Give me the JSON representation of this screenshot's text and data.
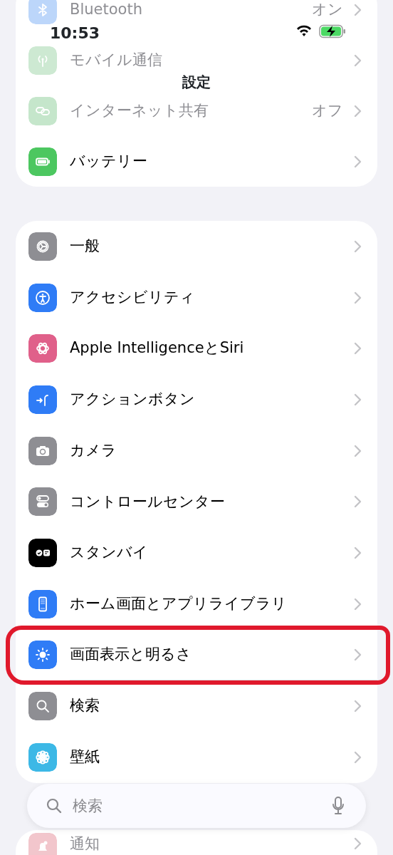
{
  "status_bar": {
    "time": "10:53"
  },
  "title": "設定",
  "groups": [
    {
      "items": [
        {
          "label": "Bluetooth",
          "value": "オン",
          "color": "#bcd6fa",
          "faded": true,
          "highlighted": false
        },
        {
          "label": "モバイル通信",
          "color": "#cde9d2",
          "faded": true,
          "highlighted": false
        },
        {
          "label": "インターネット共有",
          "value": "オフ",
          "color": "#c5e6cb",
          "faded": true,
          "highlighted": false
        },
        {
          "label": "バッテリー",
          "color": "#4cc760",
          "faded": false,
          "highlighted": false
        }
      ]
    },
    {
      "items": [
        {
          "label": "一般",
          "color": "#8e8e93",
          "faded": false,
          "highlighted": false
        },
        {
          "label": "アクセシビリティ",
          "color": "#2f7cf6",
          "faded": false,
          "highlighted": false
        },
        {
          "label": "Apple IntelligenceとSiri",
          "color": "#e0608a",
          "faded": false,
          "highlighted": false
        },
        {
          "label": "アクションボタン",
          "color": "#2f7cf6",
          "faded": false,
          "highlighted": false
        },
        {
          "label": "カメラ",
          "color": "#8e8e93",
          "faded": false,
          "highlighted": false
        },
        {
          "label": "コントロールセンター",
          "color": "#8e8e93",
          "faded": false,
          "highlighted": false
        },
        {
          "label": "スタンバイ",
          "color": "#000000",
          "faded": false,
          "highlighted": false
        },
        {
          "label": "ホーム画面とアプリライブラリ",
          "color": "#2f7cf6",
          "faded": false,
          "highlighted": false
        },
        {
          "label": "画面表示と明るさ",
          "color": "#2f7cf6",
          "faded": false,
          "highlighted": true
        },
        {
          "label": "検索",
          "color": "#8e8e93",
          "faded": false,
          "highlighted": false
        },
        {
          "label": "壁紙",
          "color": "#3cb8e6",
          "faded": false,
          "highlighted": false
        }
      ]
    },
    {
      "items": [
        {
          "label": "通知",
          "color": "#f2c6cc",
          "faded": true,
          "highlighted": false
        }
      ]
    }
  ],
  "search": {
    "placeholder": "検索"
  }
}
